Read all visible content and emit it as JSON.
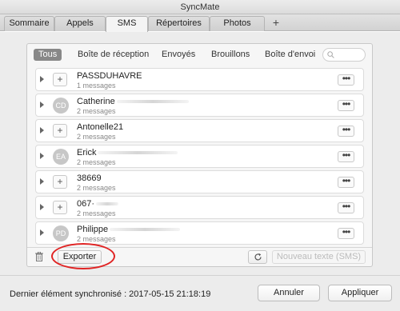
{
  "window": {
    "title": "SyncMate"
  },
  "tabs": [
    {
      "label": "Sommaire"
    },
    {
      "label": "Appels"
    },
    {
      "label": "SMS"
    },
    {
      "label": "Répertoires"
    },
    {
      "label": "Photos"
    }
  ],
  "add_tab_label": "+",
  "filters": [
    {
      "label": "Tous"
    },
    {
      "label": "Boîte de réception"
    },
    {
      "label": "Envoyés"
    },
    {
      "label": "Brouillons"
    },
    {
      "label": "Boîte d'envoi"
    }
  ],
  "conversations": [
    {
      "name": "PASSDUHAVRE",
      "count": "1 messages",
      "avatar": ""
    },
    {
      "name": "Catherine",
      "count": "2 messages",
      "avatar": "CD"
    },
    {
      "name": "Antonelle21",
      "count": "2 messages",
      "avatar": ""
    },
    {
      "name": "Erick",
      "count": "2 messages",
      "avatar": "EA"
    },
    {
      "name": "38669",
      "count": "2 messages",
      "avatar": ""
    },
    {
      "name": "067·",
      "count": "2 messages",
      "avatar": ""
    },
    {
      "name": "Philippe",
      "count": "2 messages",
      "avatar": "PD"
    }
  ],
  "toolbar": {
    "export_label": "Exporter",
    "new_text_label": "Nouveau texte (SMS)"
  },
  "footer": {
    "status": "Dernier élément synchronisé : 2017-05-15 21:18:19",
    "cancel_label": "Annuler",
    "apply_label": "Appliquer"
  },
  "colors": {
    "highlight": "#e02424",
    "active_filter": "#888888"
  }
}
